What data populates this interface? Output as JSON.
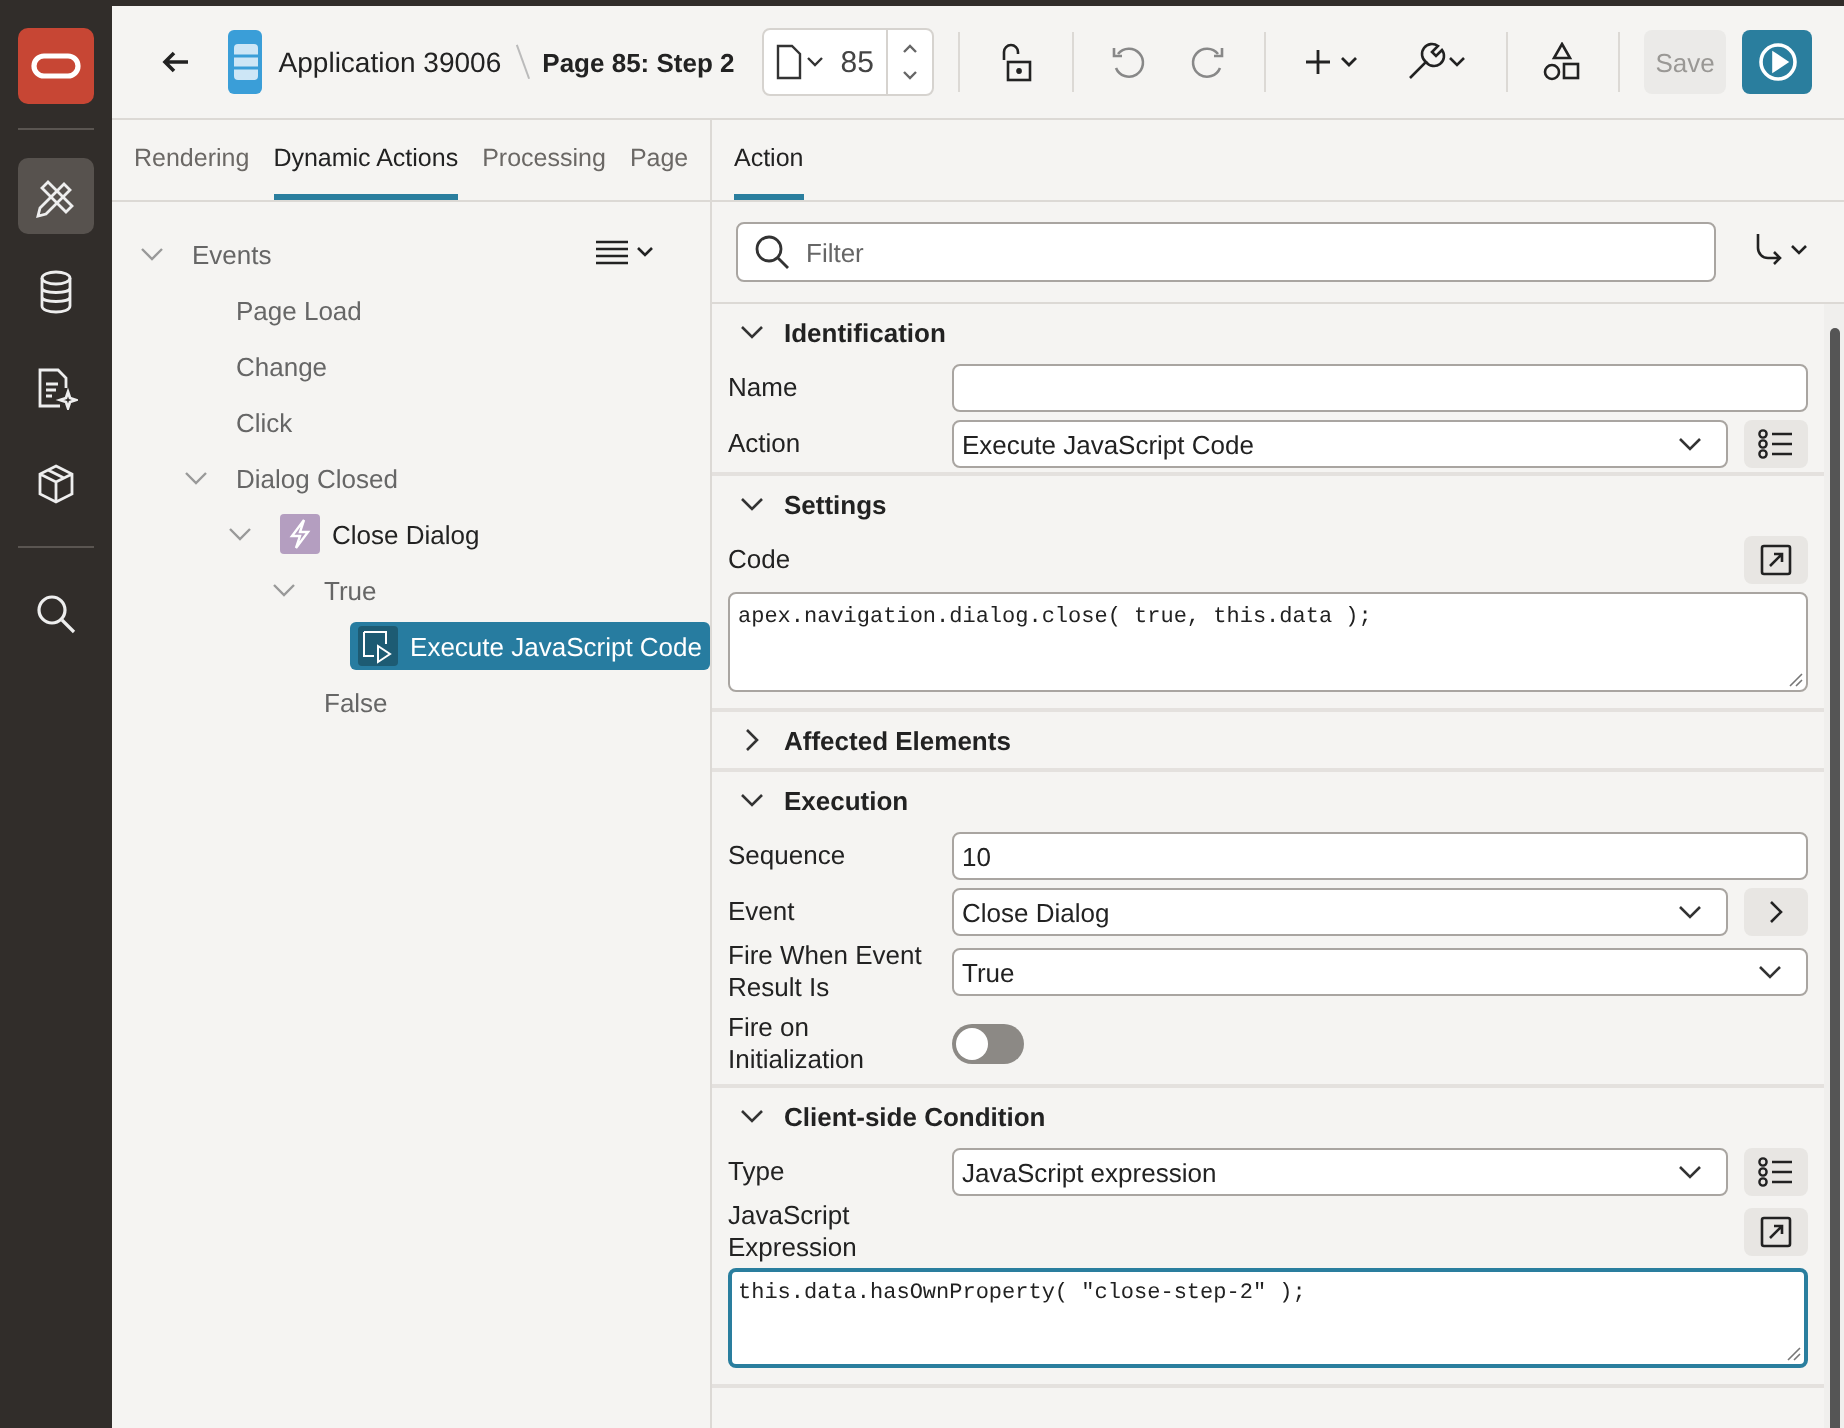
{
  "nav_items": [
    {
      "kind": "builder",
      "selected": true
    },
    {
      "kind": "database",
      "selected": false
    },
    {
      "kind": "document",
      "selected": false
    },
    {
      "kind": "package",
      "selected": false
    },
    {
      "kind": "search",
      "selected": false
    }
  ],
  "toolbar": {
    "app_title": "Application 39006",
    "page_title": "Page 85: Step 2",
    "page_number": "85",
    "save_button": {
      "label": "Save",
      "disabled": true
    }
  },
  "left_tabs": [
    {
      "label": "Rendering",
      "selected": false
    },
    {
      "label": "Dynamic Actions",
      "selected": true
    },
    {
      "label": "Processing",
      "selected": false
    },
    {
      "label": "Page",
      "selected": false
    }
  ],
  "tree": [
    {
      "label": "Events",
      "expanded": true,
      "selected": false,
      "children": [
        {
          "label": "Page Load",
          "selected": false
        },
        {
          "label": "Change",
          "selected": false
        },
        {
          "label": "Click",
          "selected": false
        },
        {
          "label": "Dialog Closed",
          "expanded": true,
          "selected": false,
          "children": [
            {
              "label": "Close Dialog",
              "kind": "dynamic_action",
              "expanded": true,
              "selected": false,
              "children": [
                {
                  "label": "True",
                  "expanded": true,
                  "selected": false,
                  "children": [
                    {
                      "label": "Execute JavaScript Code",
                      "kind": "action",
                      "selected": true
                    }
                  ]
                },
                {
                  "label": "False",
                  "selected": false
                }
              ]
            }
          ]
        }
      ]
    }
  ],
  "right_tabs": [
    {
      "label": "Action",
      "selected": true
    }
  ],
  "filter": {
    "placeholder": "Filter"
  },
  "sections": [
    {
      "title": "Identification",
      "expanded": true,
      "fields": [
        {
          "kind": "text",
          "label": "Name"
        },
        {
          "kind": "select",
          "label": "Action",
          "value": "Execute JavaScript Code",
          "side_button": {
            "kind": "list"
          }
        }
      ]
    },
    {
      "title": "Settings",
      "expanded": true,
      "fields": [
        {
          "kind": "code",
          "label": "Code",
          "value": "apex.navigation.dialog.close( true, this.data );",
          "focused": false
        }
      ]
    },
    {
      "title": "Affected Elements",
      "expanded": false
    },
    {
      "title": "Execution",
      "expanded": true,
      "fields": [
        {
          "kind": "text",
          "label": "Sequence",
          "value": "10"
        },
        {
          "kind": "select",
          "label": "Event",
          "value": "Close Dialog",
          "side_button": {
            "kind": "arrow"
          }
        },
        {
          "kind": "select",
          "label": "Fire When Event Result Is",
          "value": "True"
        },
        {
          "kind": "switch",
          "label": "Fire on Initialization",
          "on": false
        }
      ]
    },
    {
      "title": "Client-side Condition",
      "expanded": true,
      "fields": [
        {
          "kind": "select",
          "label": "Type",
          "value": "JavaScript expression",
          "side_button": {
            "kind": "list"
          }
        },
        {
          "kind": "code",
          "label": "JavaScript Expression",
          "value": "this.data.hasOwnProperty( \"close-step-2\" );",
          "focused": true
        }
      ]
    }
  ]
}
